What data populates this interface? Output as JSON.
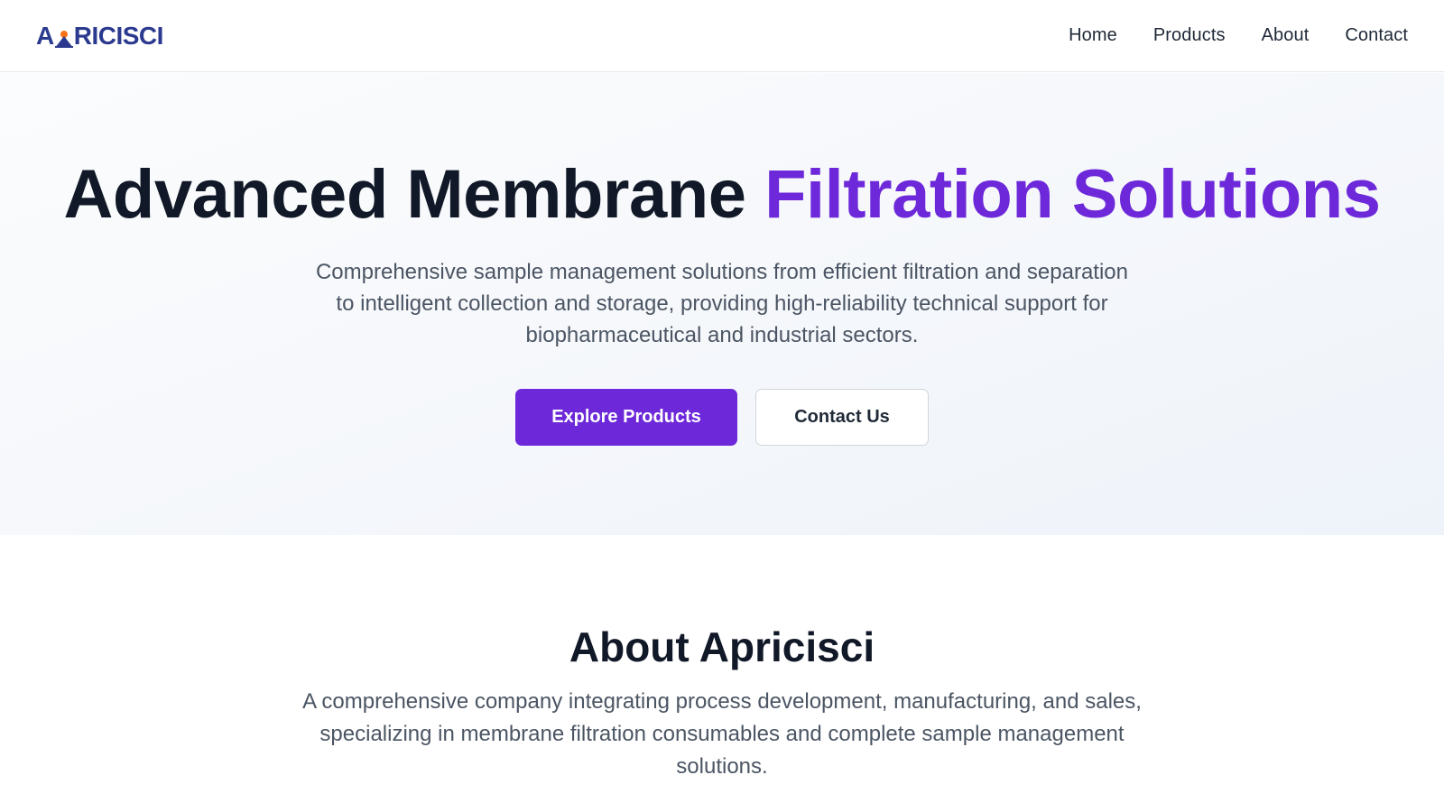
{
  "header": {
    "logo_text": "APRICISCI",
    "nav": [
      {
        "label": "Home"
      },
      {
        "label": "Products"
      },
      {
        "label": "About"
      },
      {
        "label": "Contact"
      }
    ]
  },
  "hero": {
    "title_main": "Advanced Membrane ",
    "title_accent": "Filtration Solutions",
    "subtitle": "Comprehensive sample management solutions from efficient filtration and separation to intelligent collection and storage, providing high-reliability technical support for biopharmaceutical and industrial sectors.",
    "primary_button": "Explore Products",
    "secondary_button": "Contact Us"
  },
  "about": {
    "title": "About Apricisci",
    "text": "A comprehensive company integrating process development, manufacturing, and sales, specializing in membrane filtration consumables and complete sample management solutions."
  },
  "colors": {
    "accent": "#6d28d9",
    "logo": "#2b3a8f",
    "heading": "#111827",
    "body_text": "#4b5563"
  },
  "icons": {
    "logo_mark": "mountain-sun-logo-icon"
  }
}
